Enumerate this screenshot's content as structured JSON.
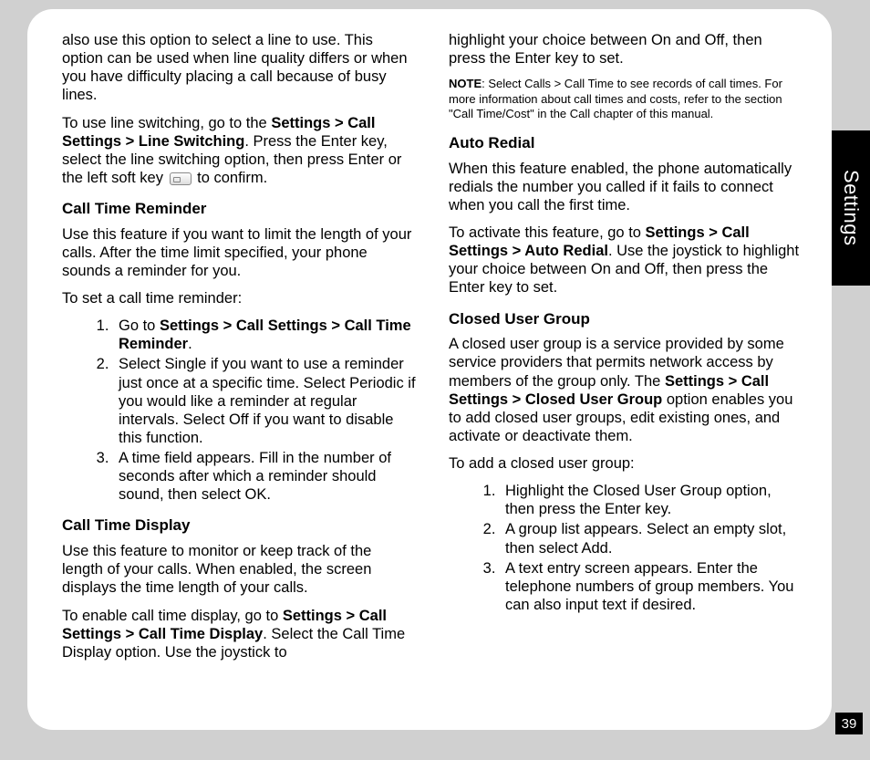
{
  "tab": {
    "label": "Settings"
  },
  "page_number": "39",
  "left": {
    "intro1": "also use this option to select a line to use. This option can be used when line quality differs or when you have difficulty placing a call because of busy lines.",
    "intro2_a": "To use line switching, go to the ",
    "intro2_bold": "Settings > Call Settings > Line Switching",
    "intro2_b": ". Press the Enter key, select the line switching option, then press Enter or the left soft key ",
    "intro2_c": " to confirm.",
    "h_ctr": "Call Time Reminder",
    "ctr_p1": "Use this feature if you want to limit the length of your calls. After the time limit specified, your phone sounds a reminder for you.",
    "ctr_p2": "To set a call time reminder:",
    "ctr_li1_a": "Go to ",
    "ctr_li1_bold": "Settings > Call Settings > Call Time Reminder",
    "ctr_li1_b": ".",
    "ctr_li2": "Select Single if you want to use a reminder just once at a specific time. Select Periodic if you would like a reminder at regular intervals. Select Off if you want to disable this function.",
    "ctr_li3": "A time field appears. Fill in the number of seconds after which a reminder should sound, then select OK.",
    "h_ctd": "Call Time Display",
    "ctd_p1": "Use this feature to monitor or keep track of the length of your calls. When enabled, the screen displays the time length of your calls.",
    "ctd_p2_a": "To enable call time display, go to ",
    "ctd_p2_bold": "Settings > Call Settings > Call Time Display",
    "ctd_p2_b": ". Select the Call Time Display option. Use the joystick to "
  },
  "right": {
    "cont_p1": "highlight your choice between On and Off, then press the Enter key to set.",
    "note_label": "NOTE",
    "note_text": ": Select Calls > Call Time to see records of call times. For more information about call times and costs, refer to the section \"Call Time/Cost\" in the Call chapter of this manual.",
    "h_ar": "Auto Redial",
    "ar_p1": "When this feature enabled, the phone automatically redials the number you called if it fails to connect when you call the first time.",
    "ar_p2_a": "To activate this feature, go to ",
    "ar_p2_bold": "Settings > Call Settings > Auto Redial",
    "ar_p2_b": ". Use the joystick to highlight your choice between On and Off, then press the Enter key to set.",
    "h_cug": "Closed User Group",
    "cug_p1_a": "A closed user group is a service provided by some service providers that permits network access by members of the group only. The ",
    "cug_p1_bold": "Settings > Call Settings > Closed User Group",
    "cug_p1_b": " option enables you to add closed user groups, edit existing ones, and activate or deactivate them.",
    "cug_p2": "To add a closed user group:",
    "cug_li1": "Highlight the Closed User Group option, then press the Enter key.",
    "cug_li2": "A group list appears. Select an empty slot, then select Add.",
    "cug_li3": "A text entry screen appears. Enter the telephone numbers of group members. You can also input text if desired."
  }
}
